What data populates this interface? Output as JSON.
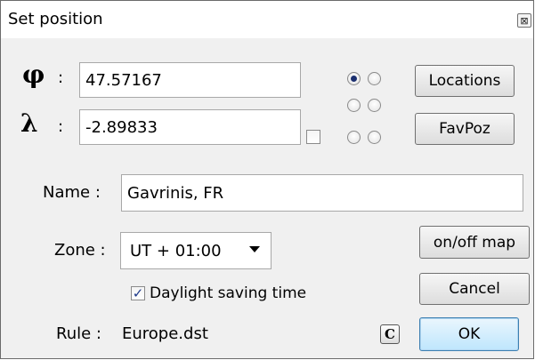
{
  "dialog": {
    "title": "Set position",
    "close_glyph": "⊠"
  },
  "latitude": {
    "symbol": "φ",
    "colon": ":",
    "value": "47.57167"
  },
  "longitude": {
    "symbol": "λ",
    "colon": ":",
    "value": "-2.89833"
  },
  "radio_grid": {
    "selected_index": 0,
    "count": 6
  },
  "longitude_checkbox": {
    "checked": false
  },
  "buttons": {
    "locations": "Locations",
    "favpoz": "FavPoz",
    "onoff_map": "on/off map",
    "cancel": "Cancel",
    "ok": "OK",
    "c_label": "C"
  },
  "name": {
    "label": "Name :",
    "value": "Gavrinis, FR"
  },
  "zone": {
    "label": "Zone :",
    "value": "UT + 01:00"
  },
  "daylight": {
    "label": "Daylight saving time",
    "checked": true,
    "check_glyph": "✓"
  },
  "rule": {
    "label": "Rule :",
    "value": "Europe.dst"
  }
}
